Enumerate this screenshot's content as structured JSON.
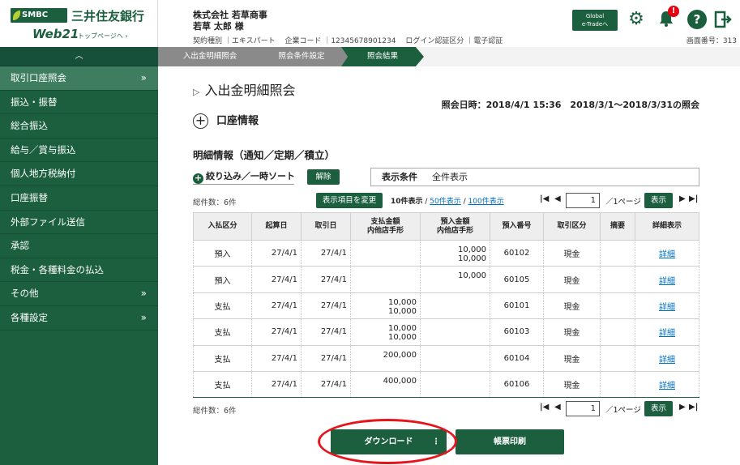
{
  "brand": {
    "badge": "SMBC",
    "bank_name": "三井住友銀行",
    "product": "Web21",
    "top_link": "トップページへ ›"
  },
  "header": {
    "company_name": "株式会社 若草商事",
    "user_name": "若草 太郎 様",
    "meta": "契約種別 ｜エキスパート　 企業コード ｜12345678901234　 ログイン認証区分 ｜電子認証",
    "global_button": "Global\ne-Tradeへ",
    "notification_count": "!",
    "help": "?",
    "screen_number": "画面番号：313"
  },
  "sidebar": {
    "collapse": "︿",
    "items": [
      {
        "label": "取引口座照会",
        "arrow": "»"
      },
      {
        "label": "振込・振替",
        "arrow": ""
      },
      {
        "label": "総合振込",
        "arrow": ""
      },
      {
        "label": "給与／賞与振込",
        "arrow": ""
      },
      {
        "label": "個人地方税納付",
        "arrow": ""
      },
      {
        "label": "口座振替",
        "arrow": ""
      },
      {
        "label": "外部ファイル送信",
        "arrow": ""
      },
      {
        "label": "承認",
        "arrow": ""
      },
      {
        "label": "税金・各種料金の払込",
        "arrow": ""
      },
      {
        "label": "その他",
        "arrow": "»"
      },
      {
        "label": "各種設定",
        "arrow": "»"
      }
    ]
  },
  "breadcrumb": [
    "入出金明細照会",
    "照会条件設定",
    "照会結果"
  ],
  "main": {
    "title_marker": "▷",
    "title": "入出金明細照会",
    "inquiry_date": "照会日時：2018/4/1 15:36　2018/3/1〜2018/3/31の照会",
    "account_section": "口座情報",
    "detail_title": "明細情報（通知／定期／積立）",
    "filter_label": "絞り込み／一時ソート",
    "clear_button": "解除",
    "condition_label": "表示条件",
    "condition_value": "全件表示",
    "total_count": "総件数：6件",
    "change_columns_button": "表示項目を変更",
    "per_page_current": "10件表示",
    "per_page_sep": " / ",
    "per_page_50": "50件表示",
    "per_page_100": "100件表示",
    "page_value": "1",
    "page_total": "／1ページ",
    "show_button": "表示",
    "nav_first": "|◀",
    "nav_prev": "◀",
    "nav_next": "▶",
    "nav_last": "▶|",
    "download_button": "ダウンロード",
    "download_menu": "⋮",
    "print_button": "帳票印刷"
  },
  "table": {
    "headers": [
      "入払区分",
      "起算日",
      "取引日",
      "支払金額\n内他店手形",
      "預入金額\n内他店手形",
      "預入番号",
      "取引区分",
      "摘要",
      "詳細表示"
    ],
    "rows": [
      {
        "type": "預入",
        "value_date": "27/4/1",
        "trade_date": "27/4/1",
        "payment": "",
        "deposit": "10,000\n10,000",
        "deposit_no": "60102",
        "category": "現金",
        "memo": "",
        "detail": "詳細"
      },
      {
        "type": "預入",
        "value_date": "27/4/1",
        "trade_date": "27/4/1",
        "payment": "",
        "deposit": "10,000",
        "deposit_no": "60105",
        "category": "現金",
        "memo": "",
        "detail": "詳細"
      },
      {
        "type": "支払",
        "value_date": "27/4/1",
        "trade_date": "27/4/1",
        "payment": "10,000\n10,000",
        "deposit": "",
        "deposit_no": "60101",
        "category": "現金",
        "memo": "",
        "detail": "詳細"
      },
      {
        "type": "支払",
        "value_date": "27/4/1",
        "trade_date": "27/4/1",
        "payment": "10,000\n10,000",
        "deposit": "",
        "deposit_no": "60103",
        "category": "現金",
        "memo": "",
        "detail": "詳細"
      },
      {
        "type": "支払",
        "value_date": "27/4/1",
        "trade_date": "27/4/1",
        "payment": "200,000",
        "deposit": "",
        "deposit_no": "60104",
        "category": "現金",
        "memo": "",
        "detail": "詳細"
      },
      {
        "type": "支払",
        "value_date": "27/4/1",
        "trade_date": "27/4/1",
        "payment": "400,000",
        "deposit": "",
        "deposit_no": "60106",
        "category": "現金",
        "memo": "",
        "detail": "詳細"
      }
    ]
  },
  "colors": {
    "brand_green": "#1b5f3f",
    "active_item": "#3e7d5f",
    "link_blue": "#0070c0",
    "alert_red": "#e60012",
    "annotation_red": "#e8141c"
  }
}
